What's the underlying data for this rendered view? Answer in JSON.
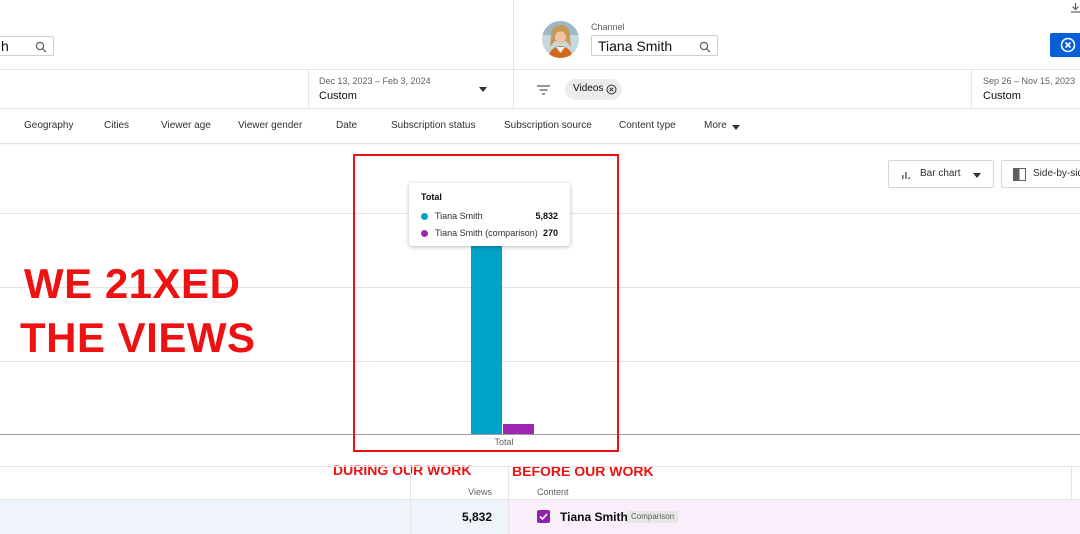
{
  "top_bar": {
    "left_search_value": "h",
    "channel_label": "Channel",
    "channel_value": "Tiana Smith"
  },
  "date_ranges": {
    "primary": {
      "range": "Dec 13, 2023 – Feb 3, 2024",
      "preset": "Custom"
    },
    "comparison": {
      "range": "Sep 26 – Nov 15, 2023",
      "preset": "Custom"
    }
  },
  "filter_chip": {
    "label": "Videos"
  },
  "tabs": [
    "Geography",
    "Cities",
    "Viewer age",
    "Viewer gender",
    "Date",
    "Subscription status",
    "Subscription source",
    "Content type",
    "More"
  ],
  "controls": {
    "chart_type": "Bar chart",
    "layout": "Side-by-side"
  },
  "chart_data": {
    "type": "bar",
    "categories": [
      "Total"
    ],
    "series": [
      {
        "name": "Tiana Smith",
        "values": [
          5832
        ],
        "color": "#00a2c7"
      },
      {
        "name": "Tiana Smith (comparison)",
        "values": [
          270
        ],
        "color": "#9c27b0"
      }
    ],
    "ylim": [
      0,
      7500
    ]
  },
  "tooltip": {
    "title": "Total",
    "rows": [
      {
        "name": "Tiana Smith",
        "value": "5,832",
        "color": "#00a2c7"
      },
      {
        "name": "Tiana Smith (comparison)",
        "value": "270",
        "color": "#9c27b0"
      }
    ]
  },
  "overlay": {
    "headline_line1": "WE 21XED",
    "headline_line2": "THE VIEWS",
    "during_label": "DURING OUR WORK",
    "before_label": "BEFORE OUR WORK"
  },
  "table": {
    "headers": {
      "views": "Views",
      "content": "Content"
    },
    "row": {
      "views": "5,832",
      "channel": "Tiana Smith",
      "badge": "Comparison"
    }
  },
  "colors": {
    "accent_blue": "#065fd4",
    "annotation_red": "#ee1111"
  }
}
